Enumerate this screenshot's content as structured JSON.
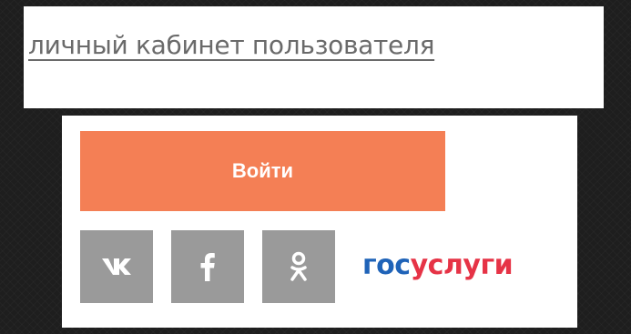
{
  "header": {
    "cabinet_link": "личный кабинет пользователя"
  },
  "login": {
    "button_label": "Войти"
  },
  "social": {
    "items": [
      {
        "name": "vk",
        "icon": "vk-icon"
      },
      {
        "name": "facebook",
        "icon": "facebook-icon"
      },
      {
        "name": "odnoklassniki",
        "icon": "odnoklassniki-icon"
      }
    ],
    "gosuslugi": {
      "part1": "гос",
      "part2": "услуги",
      "part1_color": "#1f63b8",
      "part2_color": "#e63346"
    }
  },
  "colors": {
    "accent": "#f47f55",
    "social_bg": "#9a9a9a",
    "page_bg": "#1e1e1e"
  }
}
